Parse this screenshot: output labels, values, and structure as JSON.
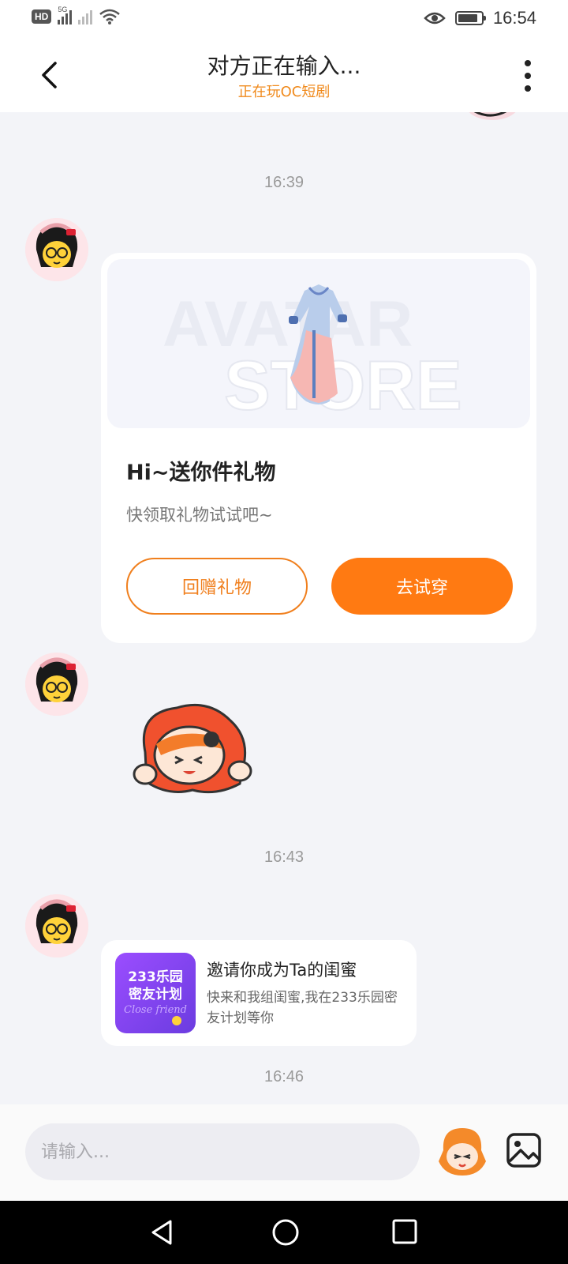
{
  "status_bar": {
    "left_badge": "HD",
    "network_label": "5G",
    "time": "16:54",
    "battery_level": 0.85
  },
  "header": {
    "title": "对方正在输入...",
    "subtitle": "正在玩OC短剧"
  },
  "messages": {
    "timestamps": [
      "16:39",
      "16:43",
      "16:46"
    ],
    "gift_card": {
      "banner_text_line1": "AVATAR",
      "banner_text_line2": "STORE",
      "title": "Hi~送你件礼物",
      "subtitle": "快领取礼物试试吧~",
      "return_gift_label": "回赠礼物",
      "try_on_label": "去试穿"
    },
    "invite_card": {
      "thumb_line1": "233乐园",
      "thumb_line2": "密友计划",
      "thumb_line3": "Close friend",
      "title": "邀请你成为Ta的闺蜜",
      "description": "快来和我组闺蜜,我在233乐园密友计划等你"
    }
  },
  "composer": {
    "placeholder": "请输入..."
  },
  "colors": {
    "accent": "#ff7a12",
    "subtitle": "#f08a1c",
    "background": "#f3f4f8"
  },
  "icons": {
    "back": "chevron-left-icon",
    "more": "more-vertical-icon",
    "emoji": "sticker-face-icon",
    "image": "image-icon",
    "eye": "eye-icon"
  }
}
